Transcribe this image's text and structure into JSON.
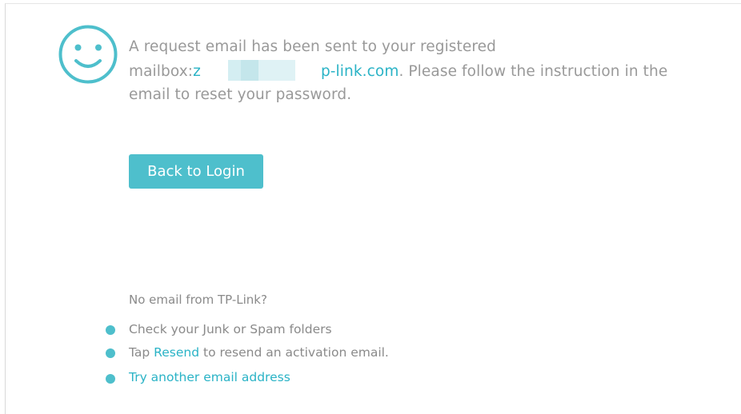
{
  "message": {
    "line1": "A request email has been sent to your registered",
    "mailbox_prefix": "mailbox:",
    "email_visible_start": "z",
    "email_visible_domain": "p-link.com",
    "line2_suffix": ". Please follow the instruction in the",
    "line3": "email to reset your password."
  },
  "actions": {
    "back_to_login": "Back to Login"
  },
  "help": {
    "heading": "No email from TP-Link?",
    "tip1": "Check your Junk or Spam folders",
    "tip2_prefix": "Tap ",
    "tip2_link": "Resend",
    "tip2_suffix": " to resend an activation email.",
    "tip3_link": "Try another email address"
  },
  "colors": {
    "accent": "#4ebfcc",
    "link": "#2ab3c6",
    "text": "#999999"
  },
  "icons": {
    "status": "smiley-icon",
    "bullet": "bullet-dot-icon"
  }
}
